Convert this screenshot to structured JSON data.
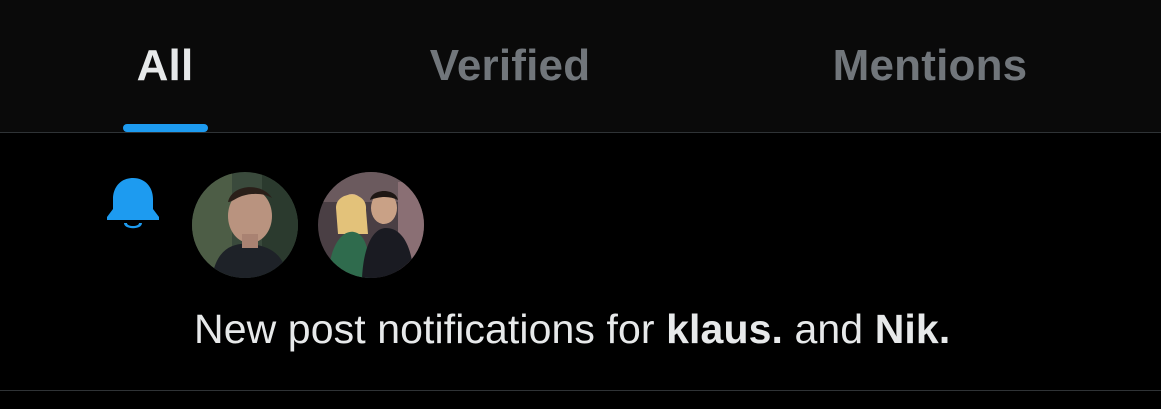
{
  "tabs": [
    {
      "label": "All",
      "active": true
    },
    {
      "label": "Verified",
      "active": false
    },
    {
      "label": "Mentions",
      "active": false
    }
  ],
  "notification": {
    "icon": "bell-icon",
    "accent_color": "#1d9bf0",
    "avatars": [
      "avatar-klaus",
      "avatar-nik"
    ],
    "text_prefix": "New post notifications for",
    "user1": "klaus.",
    "conjunction": "and",
    "user2": "Nik."
  }
}
